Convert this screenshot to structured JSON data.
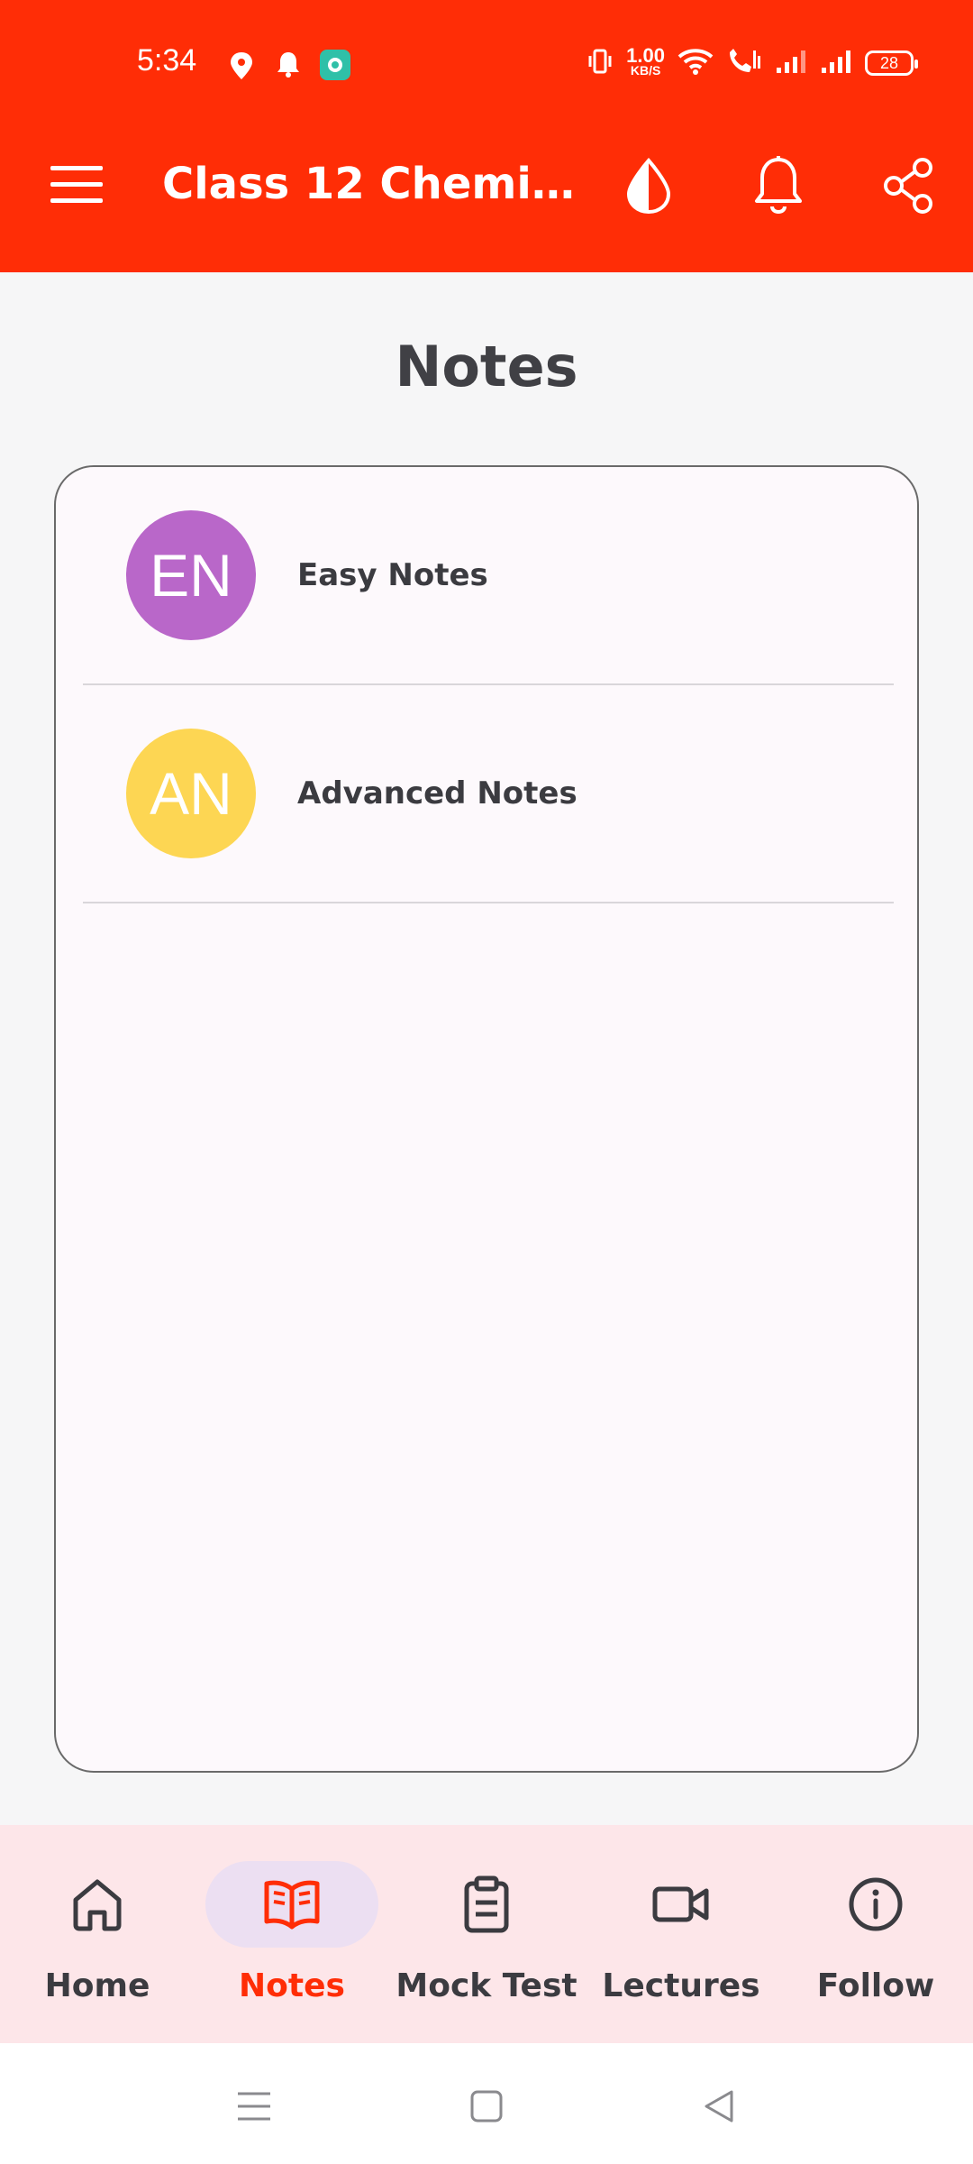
{
  "status_bar": {
    "time": "5:34",
    "speed_top": "1.00",
    "speed_bottom": "KB/S",
    "battery": "28"
  },
  "app_bar": {
    "title": "Class 12 Chemistr...",
    "icons": [
      "menu-icon",
      "contrast-icon",
      "bell-icon",
      "share-icon"
    ]
  },
  "page": {
    "title": "Notes"
  },
  "notes_list": {
    "items": [
      {
        "initials": "EN",
        "label": "Easy Notes",
        "color": "#b967c9"
      },
      {
        "initials": "AN",
        "label": "Advanced Notes",
        "color": "#fdd653"
      }
    ]
  },
  "bottom_nav": {
    "active_color": "#ff2d06",
    "active_pill": "#ecdff2",
    "items": [
      {
        "label": "Home",
        "icon": "home-icon",
        "active": false
      },
      {
        "label": "Notes",
        "icon": "book-icon",
        "active": true
      },
      {
        "label": "Mock Test",
        "icon": "clipboard-icon",
        "active": false
      },
      {
        "label": "Lectures",
        "icon": "video-icon",
        "active": false
      },
      {
        "label": "Follow",
        "icon": "info-icon",
        "active": false
      }
    ]
  }
}
